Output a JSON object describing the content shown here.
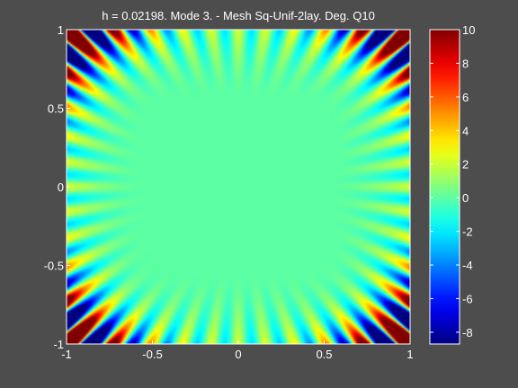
{
  "chart_data": [
    {
      "type": "heatmap",
      "title": "h  =  0.02198.  Mode 3.  -  Mesh Sq-Unif-2lay.  Deg. Q10",
      "xlabel": "",
      "ylabel": "",
      "xlim": [
        -1,
        1
      ],
      "ylim": [
        -1,
        1
      ],
      "x_ticks": [
        -1,
        -0.5,
        0,
        0.5,
        1
      ],
      "y_ticks": [
        -1,
        -0.5,
        0,
        0.5,
        1
      ],
      "x_tick_labels": [
        "-1",
        "-0.5",
        "0",
        "0.5",
        "1"
      ],
      "y_tick_labels": [
        "-1",
        "-0.5",
        "0",
        "0.5",
        "1"
      ],
      "grid": false,
      "colormap": "jet",
      "clim": [
        -8.7,
        10
      ],
      "colorbar": {
        "ticks": [
          10,
          8,
          6,
          4,
          2,
          0,
          -2,
          -4,
          -6,
          -8
        ],
        "tick_labels": [
          "10",
          "8",
          "6",
          "4",
          "2",
          "0",
          "-2",
          "-4",
          "-6",
          "-8"
        ],
        "placement": "right"
      },
      "field": {
        "description": "Whispering-gallery-like mode: field ~0 in centre, radial fan of oscillating stripes near the edges, strongest at the four corners",
        "corner_max": 10,
        "corner_min": -8.7,
        "edge_stripe_amplitude": 2.5
      }
    }
  ]
}
